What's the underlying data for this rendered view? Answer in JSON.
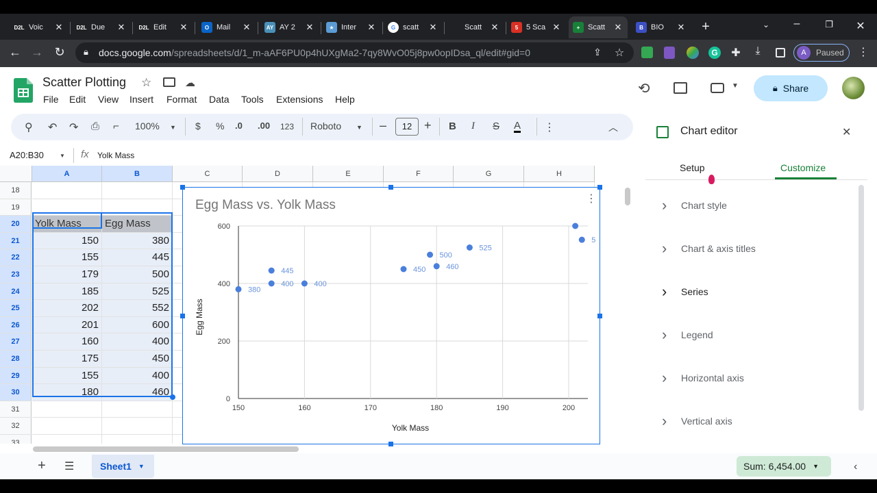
{
  "browser": {
    "tabs": [
      {
        "label": "Voic",
        "badge": "D2L",
        "color": "#202124"
      },
      {
        "label": "Due",
        "badge": "D2L",
        "color": "#202124"
      },
      {
        "label": "Edit",
        "badge": "D2L",
        "color": "#202124"
      },
      {
        "label": "Mail",
        "badge": "O",
        "color": "#0a64c8"
      },
      {
        "label": "AY 2",
        "badge": "AY",
        "color": "#4a90b8"
      },
      {
        "label": "Inter",
        "badge": "★",
        "color": "#5b9bd5"
      },
      {
        "label": "scatt",
        "badge": "G",
        "color": "#ffffff"
      },
      {
        "label": "Scatt",
        "badge": "",
        "color": "#202124"
      },
      {
        "label": "5 Sca",
        "badge": "5",
        "color": "#d93025"
      },
      {
        "label": "Scatt",
        "badge": "+",
        "color": "#188038"
      },
      {
        "label": "BIO",
        "badge": "B",
        "color": "#3c4fc4"
      }
    ],
    "url_host": "docs.google.com",
    "url_path": "/spreadsheets/d/1_m-aAF6PU0p4hUXgMa2-7qy8WvO05j8pw0opIDsa_ql/edit#gid=0",
    "profile_initial": "A",
    "profile_status": "Paused"
  },
  "doc": {
    "title": "Scatter Plotting",
    "menu": [
      "File",
      "Edit",
      "View",
      "Insert",
      "Format",
      "Data",
      "Tools",
      "Extensions",
      "Help"
    ],
    "share_label": "Share"
  },
  "toolbar": {
    "zoom": "100%",
    "currency": "$",
    "percent": "%",
    "dec_decrease": ".0",
    "dec_increase": ".00",
    "number_format": "123",
    "font": "Roboto",
    "font_size": "12",
    "bold": "B",
    "italic": "I",
    "strike": "S",
    "text_color": "A"
  },
  "formula_bar": {
    "name_box": "A20:B30",
    "fx": "fx",
    "content": "Yolk Mass"
  },
  "grid": {
    "columns": [
      "A",
      "B",
      "C",
      "D",
      "E",
      "F",
      "G",
      "H"
    ],
    "row_numbers": [
      "18",
      "19",
      "20",
      "21",
      "22",
      "23",
      "24",
      "25",
      "26",
      "27",
      "28",
      "29",
      "30",
      "31",
      "32",
      "33"
    ],
    "header_a": "Yolk Mass",
    "header_b": "Egg Mass",
    "rows": [
      [
        "150",
        "380"
      ],
      [
        "155",
        "445"
      ],
      [
        "179",
        "500"
      ],
      [
        "185",
        "525"
      ],
      [
        "202",
        "552"
      ],
      [
        "201",
        "600"
      ],
      [
        "160",
        "400"
      ],
      [
        "175",
        "450"
      ],
      [
        "155",
        "400"
      ],
      [
        "180",
        "460"
      ]
    ]
  },
  "chart_data": {
    "type": "scatter",
    "title": "Egg Mass vs. Yolk Mass",
    "xlabel": "Yolk Mass",
    "ylabel": "Egg Mass",
    "xlim": [
      150,
      203
    ],
    "ylim": [
      0,
      600
    ],
    "xticks": [
      "150",
      "160",
      "170",
      "180",
      "190",
      "200"
    ],
    "yticks": [
      "0",
      "200",
      "400",
      "600"
    ],
    "grid": true,
    "points": [
      {
        "x": 150,
        "y": 380,
        "label": "380"
      },
      {
        "x": 155,
        "y": 445,
        "label": "445"
      },
      {
        "x": 179,
        "y": 500,
        "label": "500"
      },
      {
        "x": 185,
        "y": 525,
        "label": "525"
      },
      {
        "x": 202,
        "y": 552,
        "label": "5"
      },
      {
        "x": 201,
        "y": 600,
        "label": ""
      },
      {
        "x": 160,
        "y": 400,
        "label": "400"
      },
      {
        "x": 175,
        "y": 450,
        "label": "450"
      },
      {
        "x": 155,
        "y": 400,
        "label": "400"
      },
      {
        "x": 180,
        "y": 460,
        "label": "460"
      }
    ],
    "point_color": "#4a7fdc",
    "label_color": "#6a94dd"
  },
  "editor": {
    "title": "Chart editor",
    "tab_setup": "Setup",
    "tab_customize": "Customize",
    "sections": [
      "Chart style",
      "Chart & axis titles",
      "Series",
      "Legend",
      "Horizontal axis",
      "Vertical axis"
    ]
  },
  "bottom": {
    "sheet_name": "Sheet1",
    "sum_label": "Sum: 6,454.00"
  }
}
